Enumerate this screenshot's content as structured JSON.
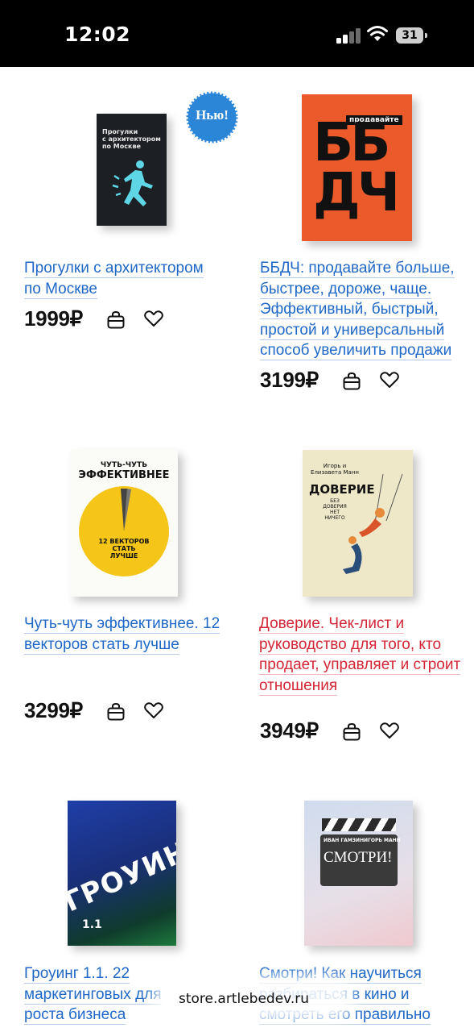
{
  "status": {
    "time": "12:02",
    "battery": "31"
  },
  "badge": "Нью!",
  "products": [
    {
      "title": "Прогулки с архитектором по Москве",
      "price": "1999₽",
      "cover_text": [
        "Прогулки",
        "с архитектором",
        "по Москве"
      ]
    },
    {
      "title": "ББДЧ: продавайте больше, быстрее, дороже, чаще. Эффективный, быстрый, простой и универсальный способ увеличить продажи",
      "price": "3199₽",
      "cover_text": [
        "продавайте",
        "ББ",
        "ДЧ"
      ]
    },
    {
      "title": "Чуть-чуть эффективнее. 12 векторов стать лучше",
      "price": "3299₽",
      "cover_text": [
        "ЧУТЬ-ЧУТЬ",
        "ЭФФЕКТИВНЕЕ",
        "12 ВЕКТОРОВ",
        "СТАТЬ",
        "ЛУЧШЕ"
      ]
    },
    {
      "title": "Доверие. Чек-лист и руководство для того, кто продает, управляет и строит отношения",
      "price": "3949₽",
      "cover_text": [
        "Игорь и Елизавета Манн",
        "ДОВЕРИЕ",
        "БЕЗ ДОВЕРИЯ НЕТ НИЧЕГО"
      ]
    },
    {
      "title": "Гроуинг 1.1. 22 маркетинговых для роста бизнеса",
      "price": "",
      "cover_text": [
        "ГРОУИНГ",
        "1.1"
      ]
    },
    {
      "title": "Смотри! Как научиться разбираться в кино и смотреть его правильно",
      "price": "",
      "cover_text": [
        "ИВАН ГАМЗИН",
        "ИГОРЬ МАНН",
        "СМОТРИ!"
      ]
    }
  ],
  "url": "store.artlebedev.ru",
  "colors": {
    "link": "#1f68c7",
    "link_red": "#d32535"
  }
}
